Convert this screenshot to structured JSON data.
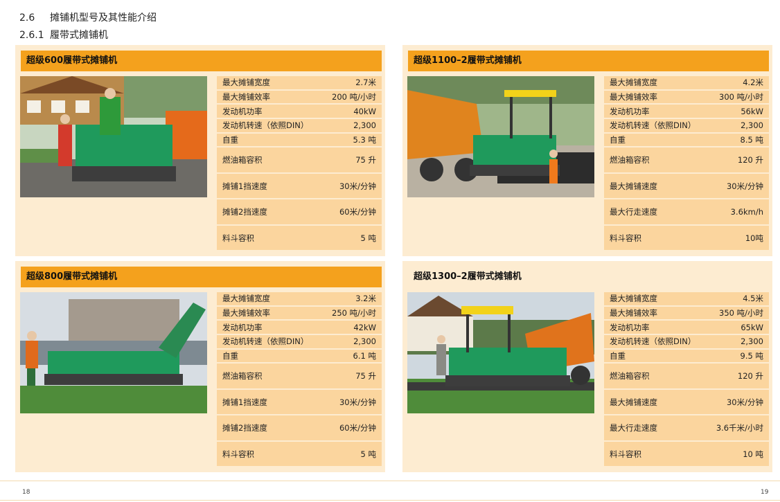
{
  "section": {
    "main_number": "2.6",
    "main_title": "摊铺机型号及其性能介绍",
    "sub_number": "2.6.1",
    "sub_title": "履带式摊铺机"
  },
  "cards": [
    {
      "title": "超级600履带式摊铺机",
      "specs": [
        {
          "label": "最大摊铺宽度",
          "value": "2.7米"
        },
        {
          "label": "最大摊铺效率",
          "value": "200 吨/小时"
        },
        {
          "label": "发动机功率",
          "value": "40kW"
        },
        {
          "label": "发动机转速（依照DIN）",
          "value": "2,300"
        },
        {
          "label": "自重",
          "value": "5.3 吨"
        },
        {
          "label": "燃油箱容积",
          "value": "75 升"
        },
        {
          "label": "摊铺1挡速度",
          "value": "30米/分钟"
        },
        {
          "label": "摊铺2挡速度",
          "value": "60米/分钟"
        },
        {
          "label": "料斗容积",
          "value": "5 吨"
        }
      ]
    },
    {
      "title": "超级1100–2履带式摊铺机",
      "specs": [
        {
          "label": "最大摊铺宽度",
          "value": "4.2米"
        },
        {
          "label": "最大摊铺效率",
          "value": "300 吨/小时"
        },
        {
          "label": "发动机功率",
          "value": "56kW"
        },
        {
          "label": "发动机转速（依照DIN）",
          "value": "2,300"
        },
        {
          "label": "自重",
          "value": "8.5 吨"
        },
        {
          "label": "燃油箱容积",
          "value": "120 升"
        },
        {
          "label": "最大摊铺速度",
          "value": "30米/分钟"
        },
        {
          "label": "最大行走速度",
          "value": "3.6km/h"
        },
        {
          "label": "料斗容积",
          "value": "10吨"
        }
      ]
    },
    {
      "title": "超级800履带式摊铺机",
      "specs": [
        {
          "label": "最大摊铺宽度",
          "value": "3.2米"
        },
        {
          "label": "最大摊铺效率",
          "value": "250 吨/小时"
        },
        {
          "label": "发动机功率",
          "value": "42kW"
        },
        {
          "label": "发动机转速（依照DIN）",
          "value": "2,300"
        },
        {
          "label": "自重",
          "value": "6.1 吨"
        },
        {
          "label": "燃油箱容积",
          "value": "75 升"
        },
        {
          "label": "摊铺1挡速度",
          "value": "30米/分钟"
        },
        {
          "label": "摊铺2挡速度",
          "value": "60米/分钟"
        },
        {
          "label": "料斗容积",
          "value": "5 吨"
        }
      ]
    },
    {
      "title": "超级1300–2履带式摊铺机",
      "specs": [
        {
          "label": "最大摊铺宽度",
          "value": "4.5米"
        },
        {
          "label": "最大摊铺效率",
          "value": "350 吨/小时"
        },
        {
          "label": "发动机功率",
          "value": "65kW"
        },
        {
          "label": "发动机转速（依照DIN）",
          "value": "2,300"
        },
        {
          "label": "自重",
          "value": "9.5 吨"
        },
        {
          "label": "燃油箱容积",
          "value": "120 升"
        },
        {
          "label": "最大摊铺速度",
          "value": "30米/分钟"
        },
        {
          "label": "最大行走速度",
          "value": "3.6千米/小时"
        },
        {
          "label": "料斗容积",
          "value": "10 吨"
        }
      ]
    }
  ],
  "pages": {
    "left": "18",
    "right": "19"
  },
  "colors": {
    "header_orange": "#f4a11d",
    "card_bg": "#fdecd1",
    "row_bg": "#fbd59e",
    "machine_green": "#1f9a5c"
  }
}
